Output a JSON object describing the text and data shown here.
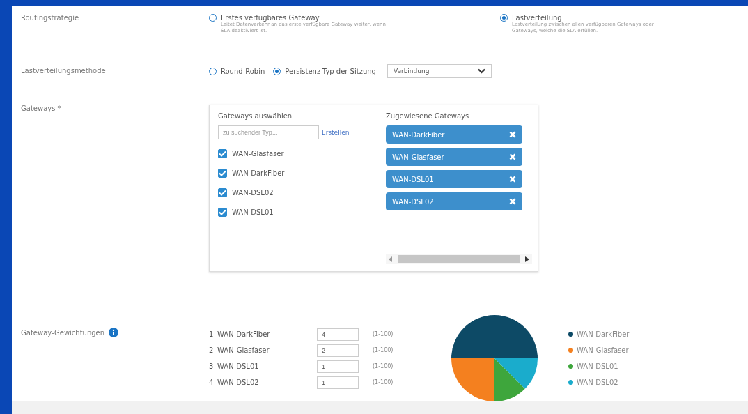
{
  "routing": {
    "label": "Routingstrategie",
    "options": [
      {
        "title": "Erstes verfügbares Gateway",
        "description": "Leitet Datenverkehr an das erste verfügbare Gateway weiter, wenn SLA deaktiviert ist.",
        "selected": false
      },
      {
        "title": "Lastverteilung",
        "description": "Lastverteilung zwischen allen verfügbaren Gateways oder Gateways, welche die SLA erfüllen.",
        "selected": true
      }
    ]
  },
  "method": {
    "label": "Lastverteilungsmethode",
    "options": [
      {
        "title": "Round-Robin",
        "selected": false
      },
      {
        "title": "Persistenz-Typ der Sitzung",
        "selected": true
      }
    ],
    "dropdown": "Verbindung"
  },
  "gateways": {
    "label": "Gateways *",
    "select_title": "Gateways auswählen",
    "search_placeholder": "zu suchender Typ...",
    "create_link": "Erstellen",
    "items": [
      {
        "name": "WAN-Glasfaser",
        "checked": true
      },
      {
        "name": "WAN-DarkFiber",
        "checked": true
      },
      {
        "name": "WAN-DSL02",
        "checked": true
      },
      {
        "name": "WAN-DSL01",
        "checked": true
      }
    ],
    "assigned_title": "Zugewiesene Gateways",
    "assigned": [
      "WAN-DarkFiber",
      "WAN-Glasfaser",
      "WAN-DSL01",
      "WAN-DSL02"
    ]
  },
  "weights": {
    "label": "Gateway-Gewichtungen",
    "rows": [
      {
        "index": "1",
        "name": "WAN-DarkFiber",
        "value": "4",
        "range": "(1-100)"
      },
      {
        "index": "2",
        "name": "WAN-Glasfaser",
        "value": "2",
        "range": "(1-100)"
      },
      {
        "index": "3",
        "name": "WAN-DSL01",
        "value": "1",
        "range": "(1-100)"
      },
      {
        "index": "4",
        "name": "WAN-DSL02",
        "value": "1",
        "range": "(1-100)"
      }
    ],
    "chart_data": {
      "type": "pie",
      "categories": [
        "WAN-DarkFiber",
        "WAN-Glasfaser",
        "WAN-DSL01",
        "WAN-DSL02"
      ],
      "values": [
        4,
        2,
        1,
        1
      ],
      "colors": [
        "#0d4a66",
        "#f4801f",
        "#3ea63c",
        "#1aaccc"
      ]
    }
  }
}
